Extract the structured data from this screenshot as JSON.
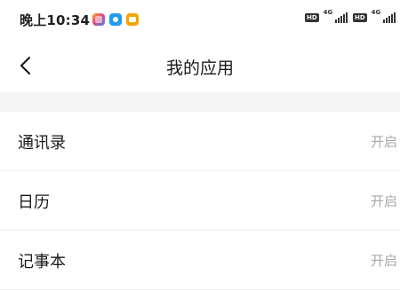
{
  "status_bar": {
    "time": "晚上10:34",
    "notification_icons": [
      "gallery-icon",
      "app-blue-icon",
      "app-orange-icon"
    ],
    "sim1": {
      "hd": "HD",
      "network": "4G"
    },
    "sim2": {
      "hd": "HD",
      "network": "4G"
    }
  },
  "header": {
    "title": "我的应用"
  },
  "apps": [
    {
      "name": "通讯录",
      "status": "开启"
    },
    {
      "name": "日历",
      "status": "开启"
    },
    {
      "name": "记事本",
      "status": "开启"
    }
  ]
}
